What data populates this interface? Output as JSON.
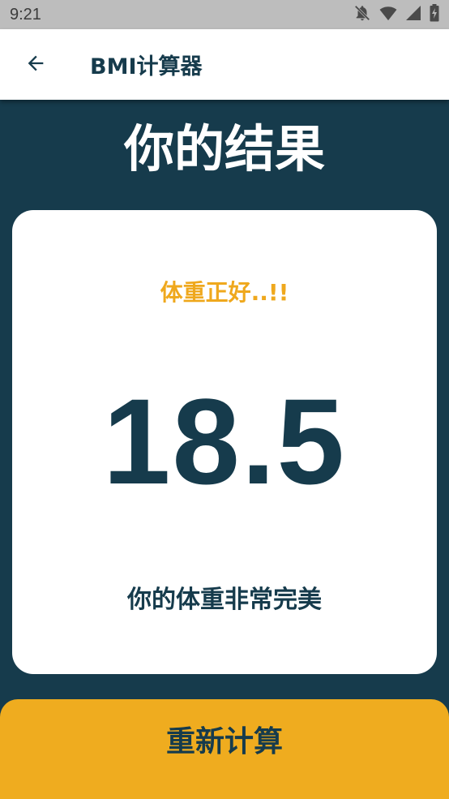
{
  "status_bar": {
    "time": "9:21",
    "icons": [
      "notifications-off-icon",
      "wifi-icon",
      "signal-icon",
      "battery-charging-icon"
    ]
  },
  "app_bar": {
    "back_icon": "arrow-back-icon",
    "title": "BMI计算器"
  },
  "result": {
    "heading": "你的结果",
    "status_label": "体重正好..!!",
    "bmi_value": "18.5",
    "advice": "你的体重非常完美"
  },
  "actions": {
    "recalculate_label": "重新计算"
  },
  "colors": {
    "primary": "#163B4C",
    "accent": "#EFA81D",
    "card": "#FFFFFF",
    "status_bar": "#BDBDBD"
  }
}
